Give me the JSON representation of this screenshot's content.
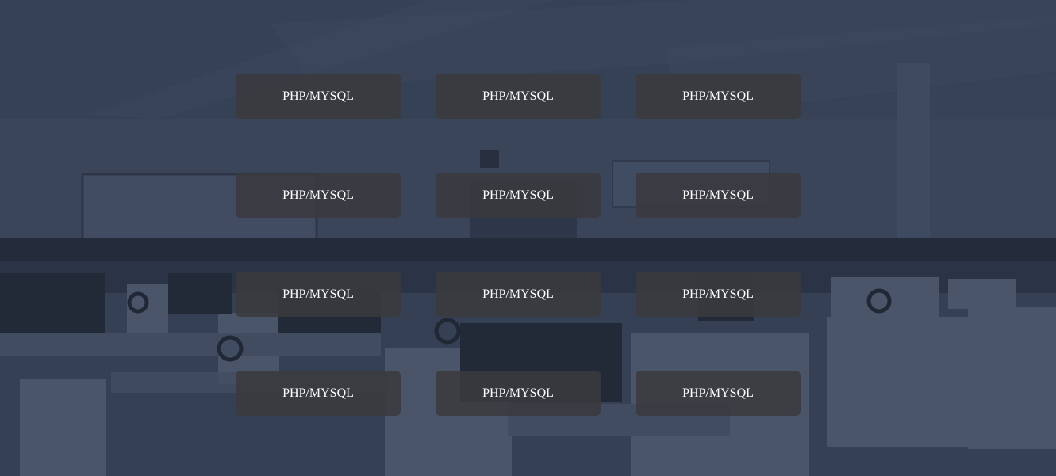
{
  "grid": {
    "tiles": [
      {
        "label": "PHP/MYSQL"
      },
      {
        "label": "PHP/MYSQL"
      },
      {
        "label": "PHP/MYSQL"
      },
      {
        "label": "PHP/MYSQL"
      },
      {
        "label": "PHP/MYSQL"
      },
      {
        "label": "PHP/MYSQL"
      },
      {
        "label": "PHP/MYSQL"
      },
      {
        "label": "PHP/MYSQL"
      },
      {
        "label": "PHP/MYSQL"
      },
      {
        "label": "PHP/MYSQL"
      },
      {
        "label": "PHP/MYSQL"
      },
      {
        "label": "PHP/MYSQL"
      }
    ]
  },
  "colors": {
    "overlay": "#3a4558",
    "tile_bg": "#3a3a3e",
    "tile_text": "#ffffff"
  }
}
